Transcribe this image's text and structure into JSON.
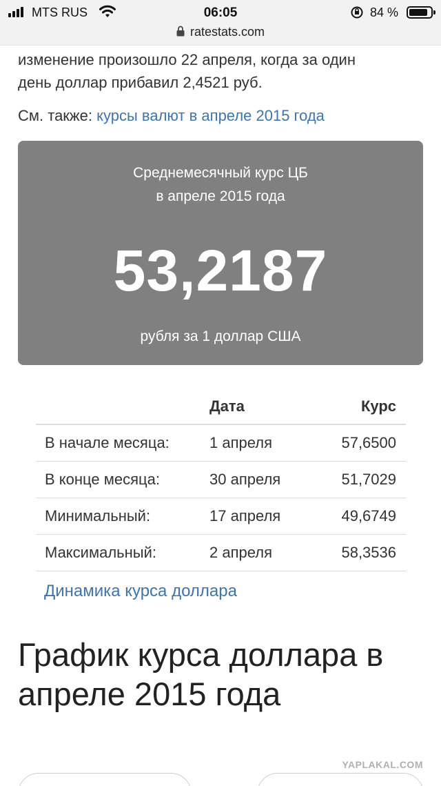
{
  "status_bar": {
    "carrier": "MTS RUS",
    "time": "06:05",
    "battery": "84 %"
  },
  "browser": {
    "url": "ratestats.com"
  },
  "article": {
    "intro_line1": "изменение произошло 22 апреля, когда за один",
    "intro_line2": "день доллар прибавил 2,4521 руб.",
    "see_also_label": "См. также:",
    "see_also_link": "курсы валют в апреле 2015 года"
  },
  "summary_card": {
    "title_line1": "Среднемесячный курс ЦБ",
    "title_line2": "в апреле 2015 года",
    "value": "53,2187",
    "subtitle": "рубля за 1 доллар США"
  },
  "rates_table": {
    "headers": [
      "",
      "Дата",
      "Курс"
    ],
    "rows": [
      {
        "label": "В начале месяца:",
        "date": "1 апреля",
        "rate": "57,6500"
      },
      {
        "label": "В конце месяца:",
        "date": "30 апреля",
        "rate": "51,7029"
      },
      {
        "label": "Минимальный:",
        "date": "17 апреля",
        "rate": "49,6749"
      },
      {
        "label": "Максимальный:",
        "date": "2 апреля",
        "rate": "58,3536"
      }
    ]
  },
  "dynamics_link": "Динамика курса доллара",
  "chart_heading": "График курса доллара в апреле 2015 года",
  "watermark": "YAPLAKAL.COM"
}
